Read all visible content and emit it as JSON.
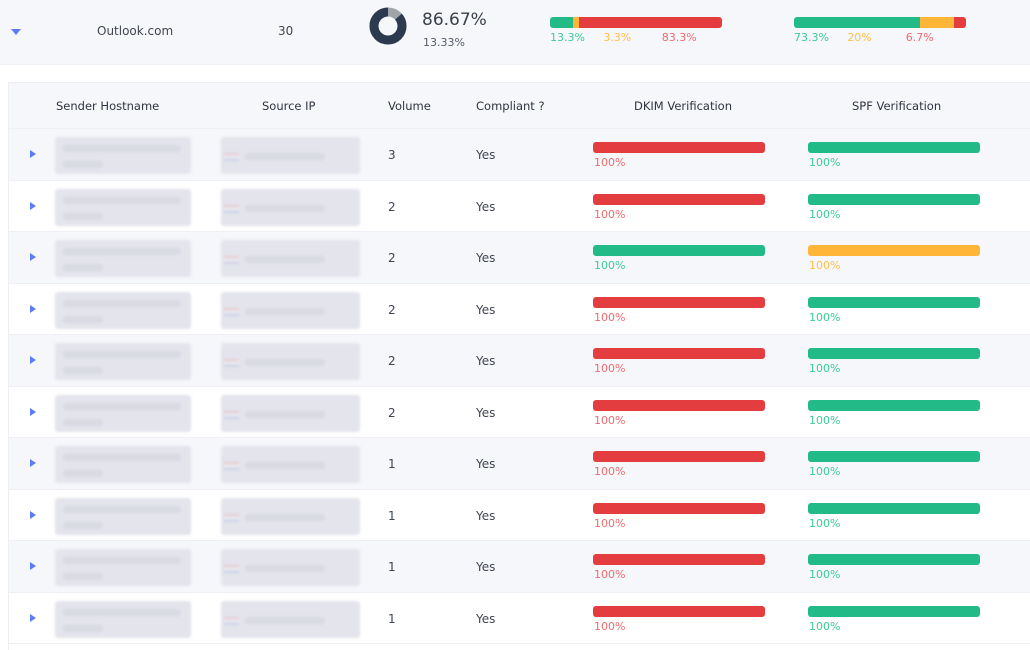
{
  "colors": {
    "pass": "#22bb88",
    "warn": "#ffb638",
    "fail": "#e33d3f",
    "pass_text": "#3ccb97",
    "warn_text": "#ffbf4a",
    "fail_text": "#ee6b6e",
    "accent": "#5b7cf5",
    "donut_main": "#2b3a4f",
    "donut_rest": "#a0a4ab"
  },
  "summary": {
    "provider": "Outlook.com",
    "volume": "30",
    "compliance": {
      "main_pct": 86.67,
      "main_label": "86.67%",
      "rest_label": "13.33%"
    },
    "dkim": [
      {
        "status": "pass",
        "value": 13.3,
        "label": "13.3%"
      },
      {
        "status": "warn",
        "value": 3.3,
        "label": "3.3%"
      },
      {
        "status": "fail",
        "value": 83.3,
        "label": "83.3%"
      }
    ],
    "spf": [
      {
        "status": "pass",
        "value": 73.3,
        "label": "73.3%"
      },
      {
        "status": "warn",
        "value": 20,
        "label": "20%"
      },
      {
        "status": "fail",
        "value": 6.7,
        "label": "6.7%"
      }
    ]
  },
  "table": {
    "columns": {
      "sender_hostname": "Sender Hostname",
      "source_ip": "Source IP",
      "volume": "Volume",
      "compliant": "Compliant ?",
      "dkim": "DKIM Verification",
      "spf": "SPF Verification"
    },
    "rows": [
      {
        "volume": "3",
        "compliant": "Yes",
        "dkim": {
          "status": "fail",
          "value": 100,
          "label": "100%"
        },
        "spf": {
          "status": "pass",
          "value": 100,
          "label": "100%"
        }
      },
      {
        "volume": "2",
        "compliant": "Yes",
        "dkim": {
          "status": "fail",
          "value": 100,
          "label": "100%"
        },
        "spf": {
          "status": "pass",
          "value": 100,
          "label": "100%"
        }
      },
      {
        "volume": "2",
        "compliant": "Yes",
        "dkim": {
          "status": "pass",
          "value": 100,
          "label": "100%"
        },
        "spf": {
          "status": "warn",
          "value": 100,
          "label": "100%"
        }
      },
      {
        "volume": "2",
        "compliant": "Yes",
        "dkim": {
          "status": "fail",
          "value": 100,
          "label": "100%"
        },
        "spf": {
          "status": "pass",
          "value": 100,
          "label": "100%"
        }
      },
      {
        "volume": "2",
        "compliant": "Yes",
        "dkim": {
          "status": "fail",
          "value": 100,
          "label": "100%"
        },
        "spf": {
          "status": "pass",
          "value": 100,
          "label": "100%"
        }
      },
      {
        "volume": "2",
        "compliant": "Yes",
        "dkim": {
          "status": "fail",
          "value": 100,
          "label": "100%"
        },
        "spf": {
          "status": "pass",
          "value": 100,
          "label": "100%"
        }
      },
      {
        "volume": "1",
        "compliant": "Yes",
        "dkim": {
          "status": "fail",
          "value": 100,
          "label": "100%"
        },
        "spf": {
          "status": "pass",
          "value": 100,
          "label": "100%"
        }
      },
      {
        "volume": "1",
        "compliant": "Yes",
        "dkim": {
          "status": "fail",
          "value": 100,
          "label": "100%"
        },
        "spf": {
          "status": "pass",
          "value": 100,
          "label": "100%"
        }
      },
      {
        "volume": "1",
        "compliant": "Yes",
        "dkim": {
          "status": "fail",
          "value": 100,
          "label": "100%"
        },
        "spf": {
          "status": "pass",
          "value": 100,
          "label": "100%"
        }
      },
      {
        "volume": "1",
        "compliant": "Yes",
        "dkim": {
          "status": "fail",
          "value": 100,
          "label": "100%"
        },
        "spf": {
          "status": "pass",
          "value": 100,
          "label": "100%"
        }
      }
    ]
  }
}
